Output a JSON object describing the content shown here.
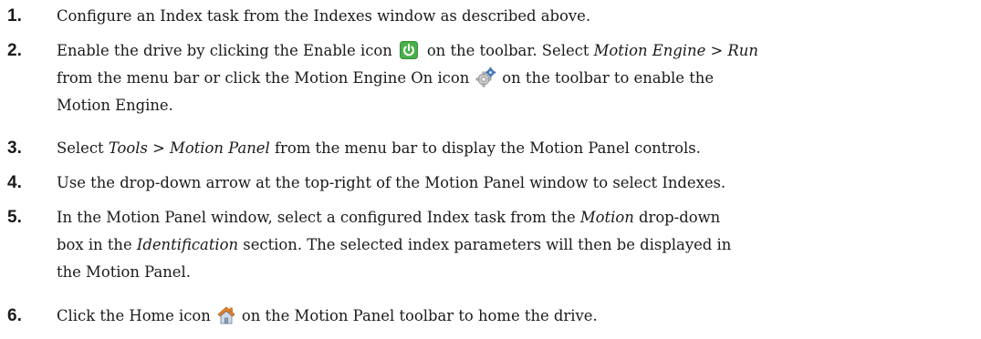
{
  "steps": [
    {
      "number": "1.",
      "lines": [
        [
          {
            "t": "Configure an Index task from the Indexes window as described above."
          }
        ]
      ]
    },
    {
      "number": "2.",
      "lines": [
        [
          {
            "t": "Enable the drive by clicking the Enable icon"
          },
          {
            "icon": "enable-icon"
          },
          {
            "t": "on the toolbar. Select "
          },
          {
            "t": "Motion Engine > Run",
            "i": true
          }
        ],
        [
          {
            "t": "from the menu bar or click the Motion Engine On icon"
          },
          {
            "icon": "motion-engine-on-icon"
          },
          {
            "t": "on the toolbar to enable the"
          }
        ],
        [
          {
            "t": "Motion Engine."
          }
        ]
      ]
    },
    {
      "number": "3.",
      "lines": [
        [
          {
            "t": "Select "
          },
          {
            "t": "Tools > Motion Panel",
            "i": true
          },
          {
            "t": " from the menu bar to display the Motion Panel controls."
          }
        ]
      ]
    },
    {
      "number": "4.",
      "lines": [
        [
          {
            "t": "Use the drop-down arrow at the top-right of the Motion Panel window to select Indexes."
          }
        ]
      ]
    },
    {
      "number": "5.",
      "lines": [
        [
          {
            "t": "In the Motion Panel window, select a configured Index task from the "
          },
          {
            "t": "Motion",
            "i": true
          },
          {
            "t": " drop-down"
          }
        ],
        [
          {
            "t": "box in the "
          },
          {
            "t": "Identification",
            "i": true
          },
          {
            "t": " section. The selected index parameters will then be displayed in"
          }
        ],
        [
          {
            "t": "the Motion Panel."
          }
        ]
      ]
    },
    {
      "number": "6.",
      "lines": [
        [
          {
            "t": "Click the Home icon"
          },
          {
            "icon": "home-icon"
          },
          {
            "t": "on the Motion Panel toolbar to home the drive."
          }
        ]
      ]
    }
  ],
  "colors": {
    "text": "#1a1a1a",
    "enable_icon_green": "#49b04a",
    "home_icon_orange": "#e8822a",
    "engine_icon_blue": "#4a7fc1"
  }
}
